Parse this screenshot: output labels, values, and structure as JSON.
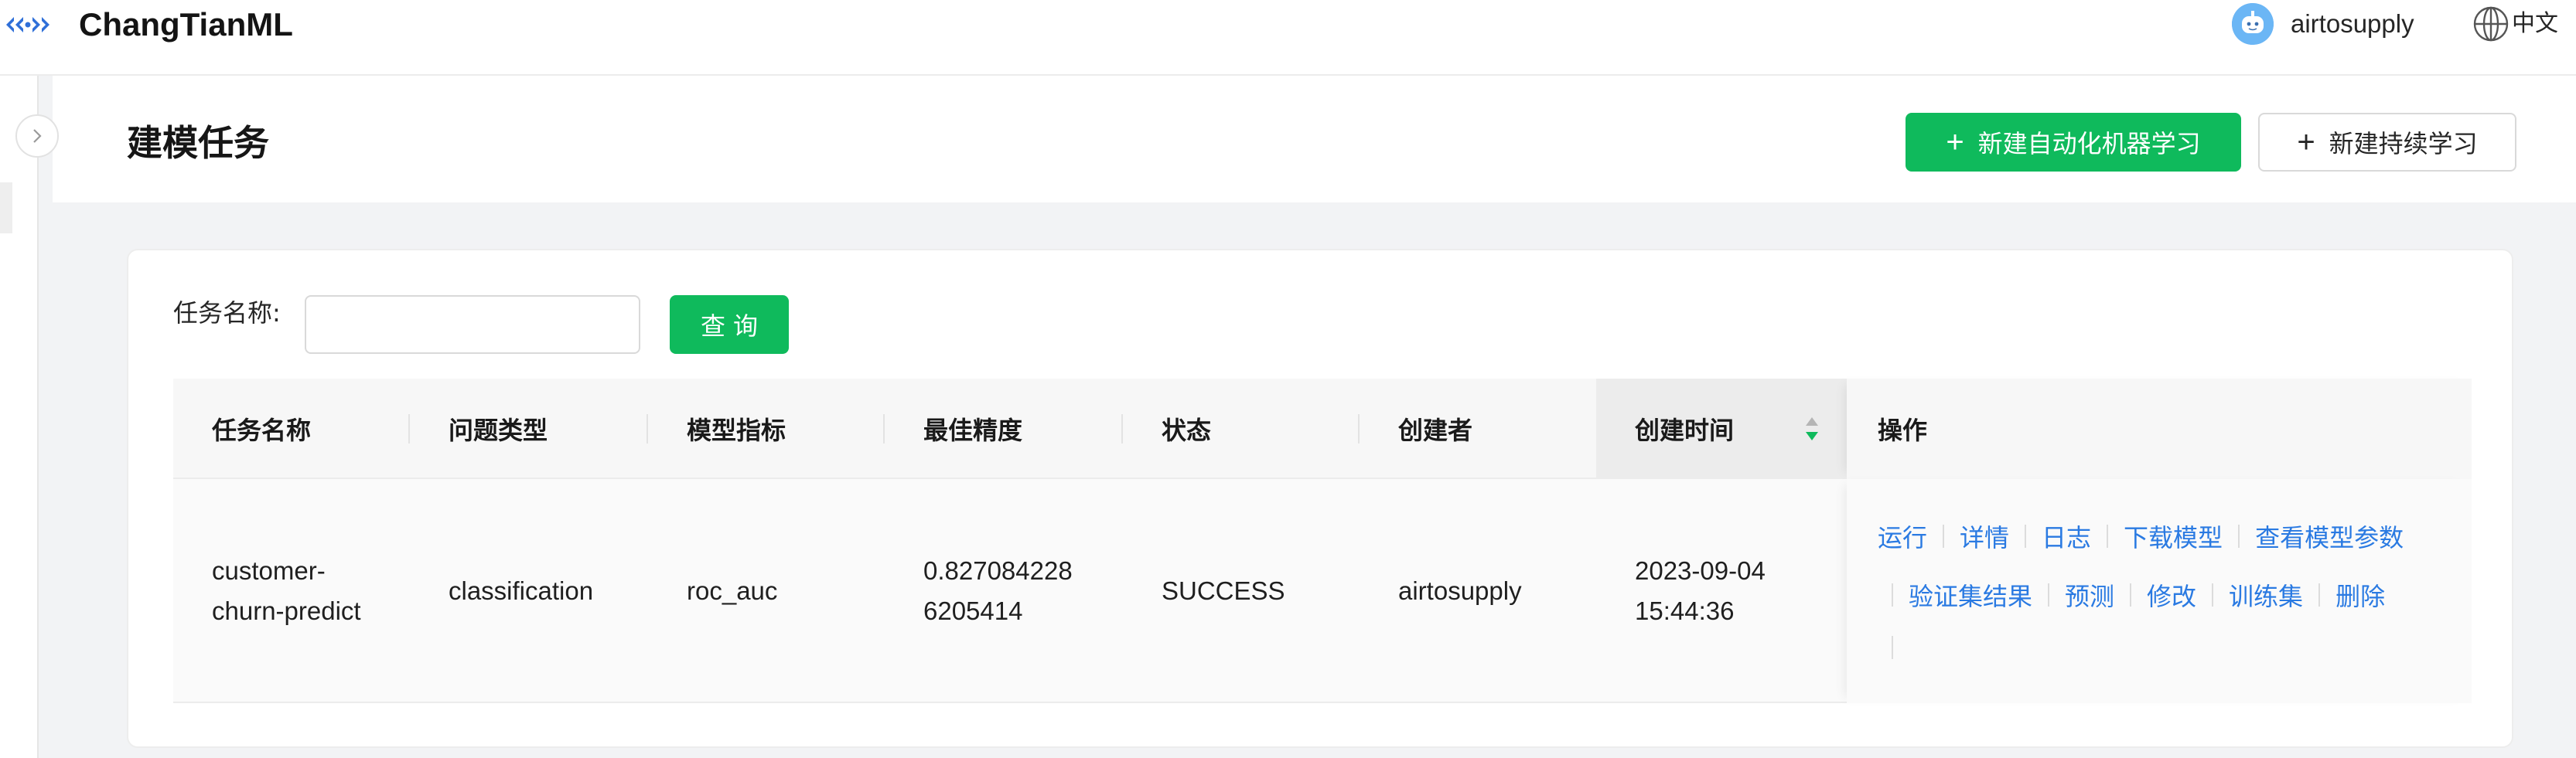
{
  "app": {
    "title": "ChangTianML",
    "brand_color": "#2f6fd8"
  },
  "user": {
    "name": "airtosupply",
    "avatar_icon": "robot-avatar-icon"
  },
  "language": {
    "label": "中文",
    "icon": "globe-icon"
  },
  "page": {
    "title": "建模任务",
    "primary_button": "新建自动化机器学习",
    "secondary_button": "新建持续学习"
  },
  "search": {
    "label": "任务名称:",
    "placeholder": "",
    "value": "",
    "query_button": "查询"
  },
  "table": {
    "columns": [
      "任务名称",
      "问题类型",
      "模型指标",
      "最佳精度",
      "状态",
      "创建者",
      "创建时间",
      "操作"
    ],
    "sorted_column": "创建时间",
    "rows": [
      {
        "name": "customer-\nchurn-predict",
        "problem_type": "classification",
        "metric": "roc_auc",
        "best_score": "0.827084228\n6205414",
        "status": "SUCCESS",
        "creator": "airtosupply",
        "created_at": "2023-09-04\n15:44:36",
        "actions_line1": [
          "运行",
          "详情",
          "日志",
          "下载模型",
          "查看模型参数"
        ],
        "actions_line2": [
          "验证集结果",
          "预测",
          "修改",
          "训练集",
          "删除"
        ]
      }
    ]
  },
  "colors": {
    "primary": "#0fba5c",
    "link": "#2a7ae2",
    "sort_active": "#0fba5c"
  }
}
